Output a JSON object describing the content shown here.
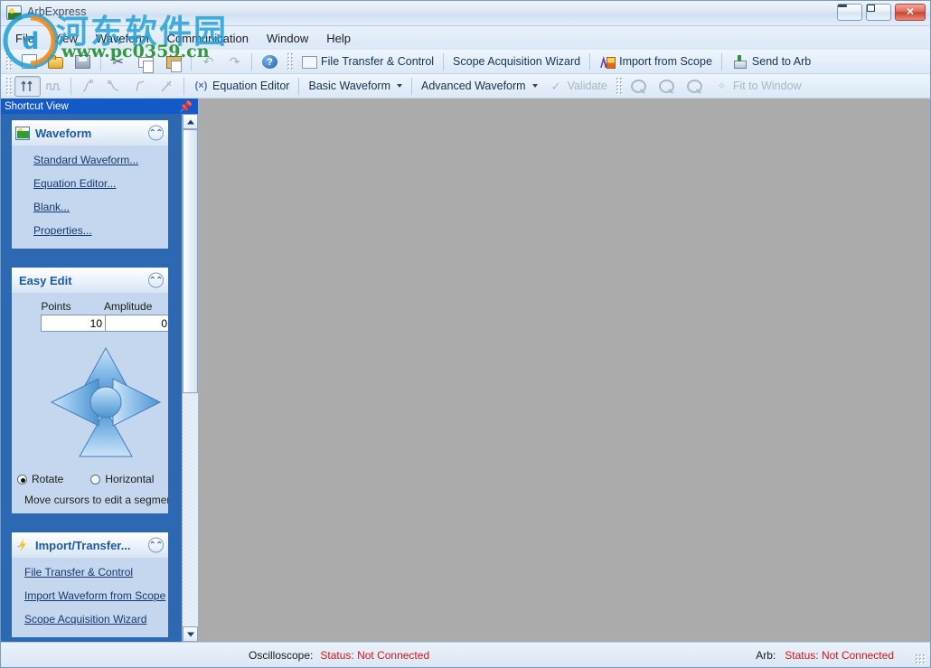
{
  "window": {
    "title": "ArbExpress",
    "app_icon": "app-icon",
    "buttons": {
      "minimize": "minimize",
      "maximize": "maximize",
      "close": "✕"
    }
  },
  "menubar": {
    "items": [
      {
        "label": "File"
      },
      {
        "label": "View"
      },
      {
        "label": "Waveform"
      },
      {
        "label": "Communication"
      },
      {
        "label": "Window"
      },
      {
        "label": "Help"
      }
    ]
  },
  "toolbar_main": {
    "icon_buttons": [
      {
        "name": "new-icon",
        "title": "New"
      },
      {
        "name": "open-icon",
        "title": "Open"
      },
      {
        "name": "save-icon",
        "title": "Save"
      },
      {
        "name": "cut-icon",
        "title": "Cut",
        "glyph": "✂"
      },
      {
        "name": "copy-icon",
        "title": "Copy"
      },
      {
        "name": "paste-icon",
        "title": "Paste"
      },
      {
        "name": "undo-icon",
        "title": "Undo",
        "glyph": "↶"
      },
      {
        "name": "redo-icon",
        "title": "Redo",
        "glyph": "↷"
      },
      {
        "name": "help-icon",
        "title": "Help"
      }
    ],
    "text_buttons": [
      {
        "label": "File Transfer & Control"
      },
      {
        "label": "Scope Acquisition Wizard"
      },
      {
        "label": "Import from Scope"
      },
      {
        "label": "Send to Arb"
      }
    ]
  },
  "toolbar_second": {
    "equation_editor": "Equation Editor",
    "basic_waveform": "Basic Waveform",
    "advanced_waveform": "Advanced Waveform",
    "validate": "Validate",
    "fit_to_window": "Fit to Window"
  },
  "sidebar": {
    "caption": "Shortcut View",
    "pin_icon": "pin-icon",
    "panels": [
      {
        "id": "waveform",
        "title": "Waveform",
        "icon": "waveform-icon",
        "collapse_icon": "chevron-up-icon",
        "links": [
          "Standard Waveform...",
          "Equation Editor...",
          "Blank...",
          "Properties..."
        ]
      },
      {
        "id": "easy-edit",
        "title": "Easy Edit",
        "icon": "",
        "collapse_icon": "chevron-up-icon",
        "labels": {
          "points": "Points",
          "amplitude": "Amplitude"
        },
        "values": {
          "points": "10",
          "amplitude": "0"
        },
        "radios": [
          {
            "label": "Rotate",
            "selected": true
          },
          {
            "label": "Horizontal",
            "selected": false
          }
        ],
        "hint": "Move cursors to edit a segment"
      },
      {
        "id": "import-transfer",
        "title": "Import/Transfer...",
        "icon": "lightning-icon",
        "collapse_icon": "chevron-up-icon",
        "links": [
          "File Transfer & Control",
          "Import  Waveform from Scope",
          "Scope Acquisition Wizard"
        ]
      }
    ]
  },
  "statusbar": {
    "oscilloscope_label": "Oscilloscope:",
    "oscilloscope_status": "Status: Not Connected",
    "arb_label": "Arb:",
    "arb_status": "Status: Not Connected"
  },
  "watermark": {
    "chinese": "河东软件园",
    "url": "www.pc0359.cn"
  },
  "colors": {
    "canvas": "#ababab",
    "accent_blue": "#1459c8",
    "panel_border": "#2d68b2",
    "status_red": "#d41515",
    "link_blue": "#15386e"
  }
}
